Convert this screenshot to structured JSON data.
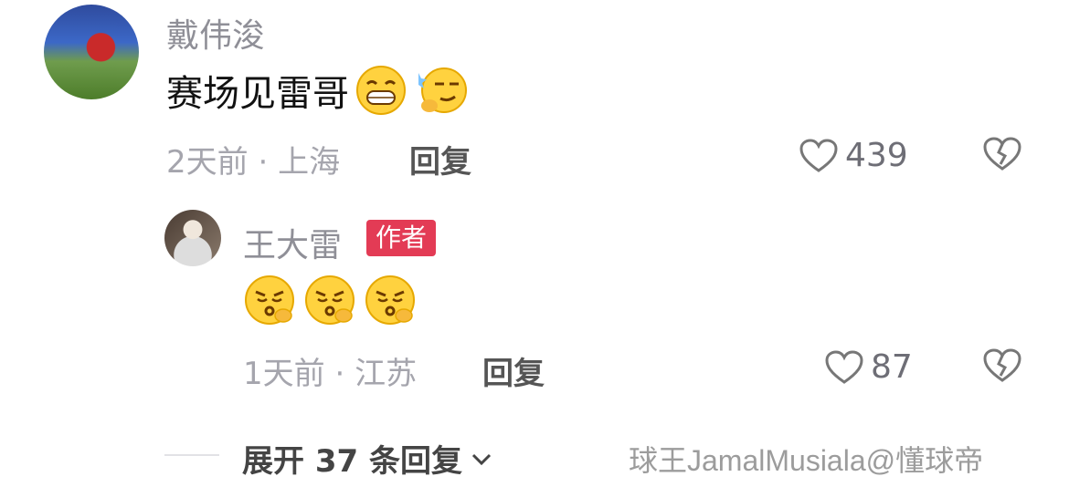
{
  "comment": {
    "username": "戴伟浚",
    "text": "赛场见雷哥",
    "emojis": [
      "grin-face",
      "thinking-smug-face"
    ],
    "time": "2天前",
    "location": "上海",
    "reply_label": "回复",
    "likes": "439"
  },
  "reply": {
    "username": "王大雷",
    "badge": "作者",
    "emojis": [
      "kissy-face",
      "kissy-face",
      "kissy-face"
    ],
    "time": "1天前",
    "location": "江苏",
    "reply_label": "回复",
    "likes": "87"
  },
  "expand": {
    "label": "展开 37 条回复",
    "icon": "chevron-down-icon"
  },
  "watermark": "球王JamalMusiala@懂球帝",
  "colors": {
    "badge": "#e33b55",
    "meta": "#a5a5ad",
    "username": "#8f8f97"
  }
}
